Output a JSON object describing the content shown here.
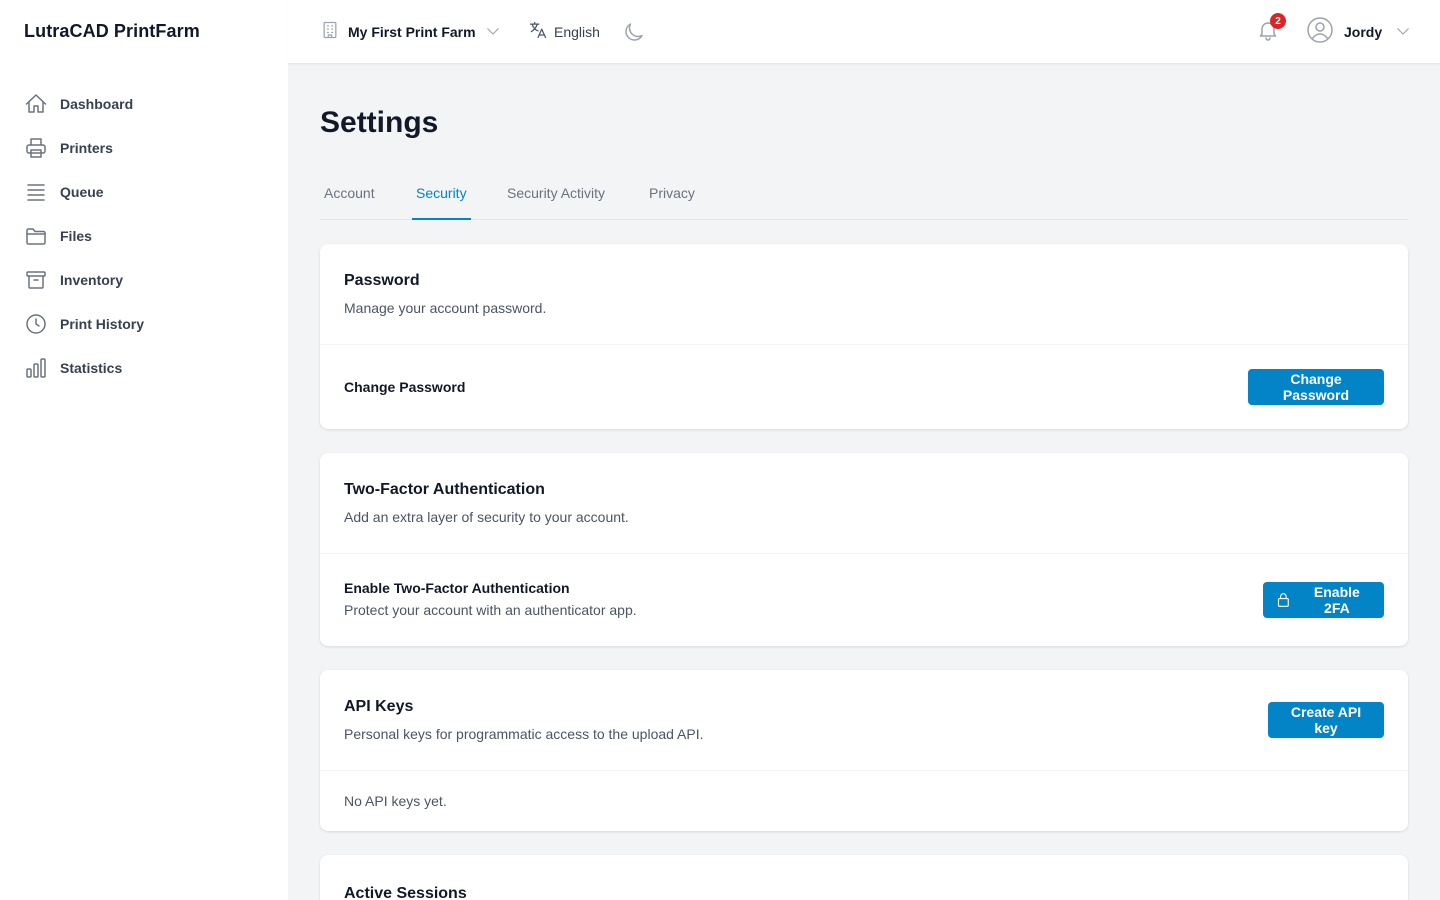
{
  "app": {
    "name": "LutraCAD PrintFarm"
  },
  "sidebar": {
    "items": [
      {
        "label": "Dashboard",
        "icon": "home-icon"
      },
      {
        "label": "Printers",
        "icon": "printer-icon"
      },
      {
        "label": "Queue",
        "icon": "queue-icon"
      },
      {
        "label": "Files",
        "icon": "folder-icon"
      },
      {
        "label": "Inventory",
        "icon": "archive-box-icon"
      },
      {
        "label": "Print History",
        "icon": "clock-icon"
      },
      {
        "label": "Statistics",
        "icon": "bar-chart-icon"
      }
    ]
  },
  "header": {
    "farm": "My First Print Farm",
    "language": "English",
    "notifications_count": "2",
    "user": "Jordy"
  },
  "page": {
    "title": "Settings",
    "tabs": [
      {
        "label": "Account",
        "active": false
      },
      {
        "label": "Security",
        "active": true
      },
      {
        "label": "Security Activity",
        "active": false
      },
      {
        "label": "Privacy",
        "active": false
      }
    ]
  },
  "password": {
    "title": "Password",
    "description": "Manage your account password.",
    "row_label": "Change Password",
    "button": "Change Password"
  },
  "twofa": {
    "title": "Two-Factor Authentication",
    "description": "Add an extra layer of security to your account.",
    "row_label": "Enable Two-Factor Authentication",
    "row_description": "Protect your account with an authenticator app.",
    "button": "Enable 2FA"
  },
  "api_keys": {
    "title": "API Keys",
    "description": "Personal keys for programmatic access to the upload API.",
    "button": "Create API key",
    "empty": "No API keys yet."
  },
  "sessions": {
    "title": "Active Sessions"
  },
  "colors": {
    "accent": "#0284c7",
    "badge": "#dc2626"
  }
}
